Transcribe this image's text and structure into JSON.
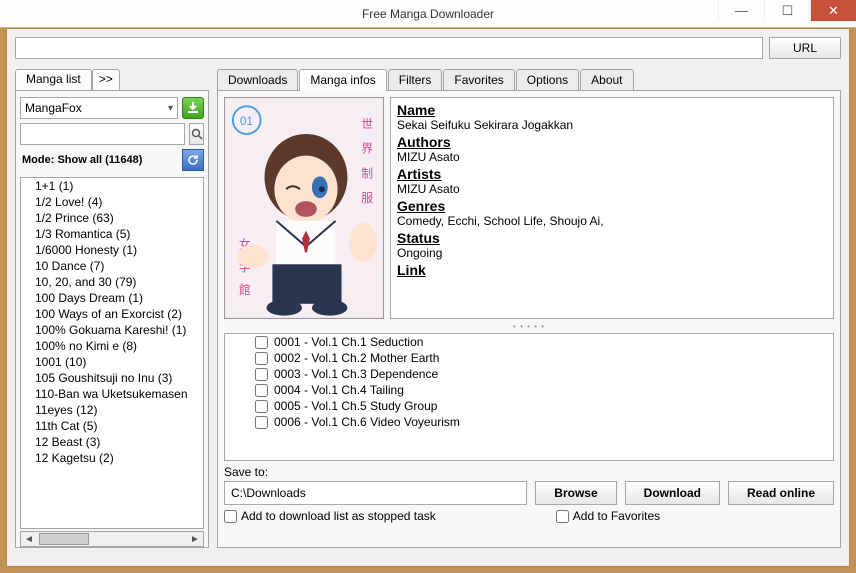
{
  "window": {
    "title": "Free Manga Downloader"
  },
  "url_button": "URL",
  "sidebar": {
    "main_tab": "Manga list",
    "expand_tab": ">>",
    "source": "MangaFox",
    "mode": "Mode: Show all (11648)",
    "items": [
      "1+1 (1)",
      "1/2 Love! (4)",
      "1/2 Prince (63)",
      "1/3 Romantica (5)",
      "1/6000 Honesty (1)",
      "10 Dance (7)",
      "10, 20, and 30 (79)",
      "100 Days Dream (1)",
      "100 Ways of an Exorcist (2)",
      "100% Gokuama Kareshi! (1)",
      "100% no Kimi e (8)",
      "1001 (10)",
      "105 Goushitsuji no Inu (3)",
      "110-Ban wa Uketsukemasen",
      "11eyes (12)",
      "11th Cat (5)",
      "12 Beast (3)",
      "12 Kagetsu (2)"
    ]
  },
  "main_tabs": [
    "Downloads",
    "Manga infos",
    "Filters",
    "Favorites",
    "Options",
    "About"
  ],
  "active_tab": 1,
  "info": {
    "name_h": "Name",
    "name": "Sekai Seifuku Sekirara Jogakkan",
    "authors_h": "Authors",
    "authors": "MIZU Asato",
    "artists_h": "Artists",
    "artists": "MIZU Asato",
    "genres_h": "Genres",
    "genres": "Comedy, Ecchi, School Life, Shoujo Ai,",
    "status_h": "Status",
    "status": "Ongoing",
    "link_h": "Link"
  },
  "chapters": [
    "0001 - Vol.1 Ch.1 Seduction",
    "0002 - Vol.1 Ch.2 Mother Earth",
    "0003 - Vol.1 Ch.3 Dependence",
    "0004 - Vol.1 Ch.4 Tailing",
    "0005 - Vol.1 Ch.5 Study Group",
    "0006 - Vol.1 Ch.6 Video Voyeurism"
  ],
  "save": {
    "label": "Save to:",
    "path": "C:\\Downloads",
    "browse": "Browse",
    "download": "Download",
    "read_online": "Read online"
  },
  "checks": {
    "stopped": "Add to download list as stopped task",
    "favorites": "Add to Favorites"
  }
}
